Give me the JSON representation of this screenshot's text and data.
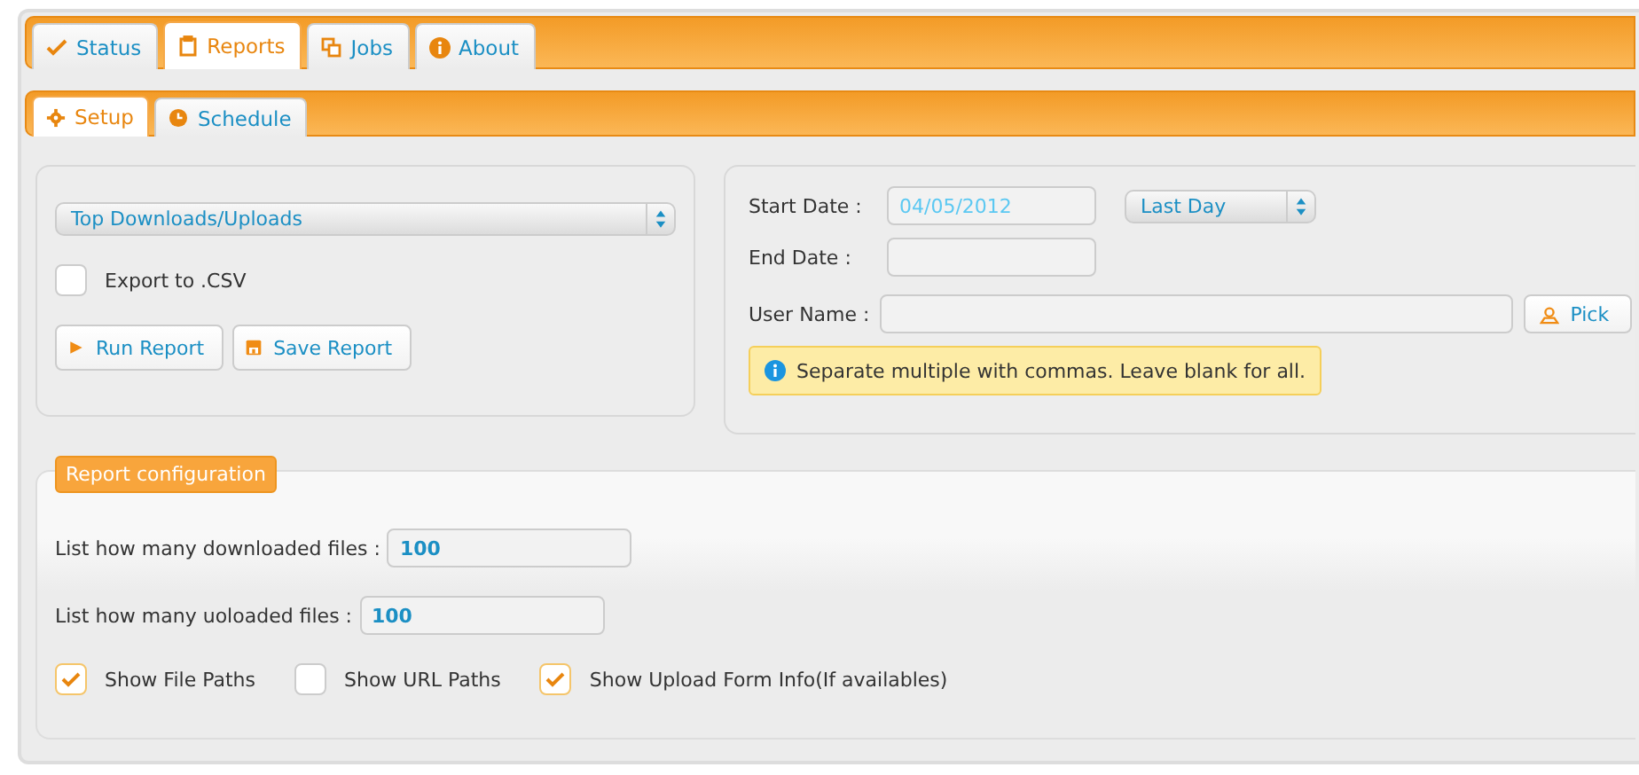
{
  "tabs": [
    {
      "label": "Status",
      "selected": false
    },
    {
      "label": "Reports",
      "selected": true
    },
    {
      "label": "Jobs",
      "selected": false
    },
    {
      "label": "About",
      "selected": false
    }
  ],
  "subtabs": [
    {
      "label": "Setup",
      "selected": true
    },
    {
      "label": "Schedule",
      "selected": false
    }
  ],
  "report_select": {
    "value": "Top Downloads/Uploads"
  },
  "export_csv": {
    "label": "Export to .CSV",
    "checked": false
  },
  "buttons": [
    "Run Report",
    "Save Report"
  ],
  "start_date": {
    "label": "Start Date :",
    "value": "04/05/2012"
  },
  "range_select": {
    "value": "Last Day"
  },
  "end_date": {
    "label": "End Date :"
  },
  "user_name": {
    "label": "User Name :",
    "button": "Pick"
  },
  "hint": "Separate multiple with commas. Leave blank for all.",
  "config": {
    "legend": "Report configuration",
    "fields": [
      {
        "label": "List how many downloaded files :",
        "value": "100"
      },
      {
        "label": "List how many uoloaded files :",
        "value": "100"
      }
    ],
    "options": [
      {
        "label": "Show File Paths",
        "checked": true
      },
      {
        "label": "Show URL Paths",
        "checked": false
      },
      {
        "label": "Show Upload Form Info(If availables)",
        "checked": true
      }
    ]
  }
}
